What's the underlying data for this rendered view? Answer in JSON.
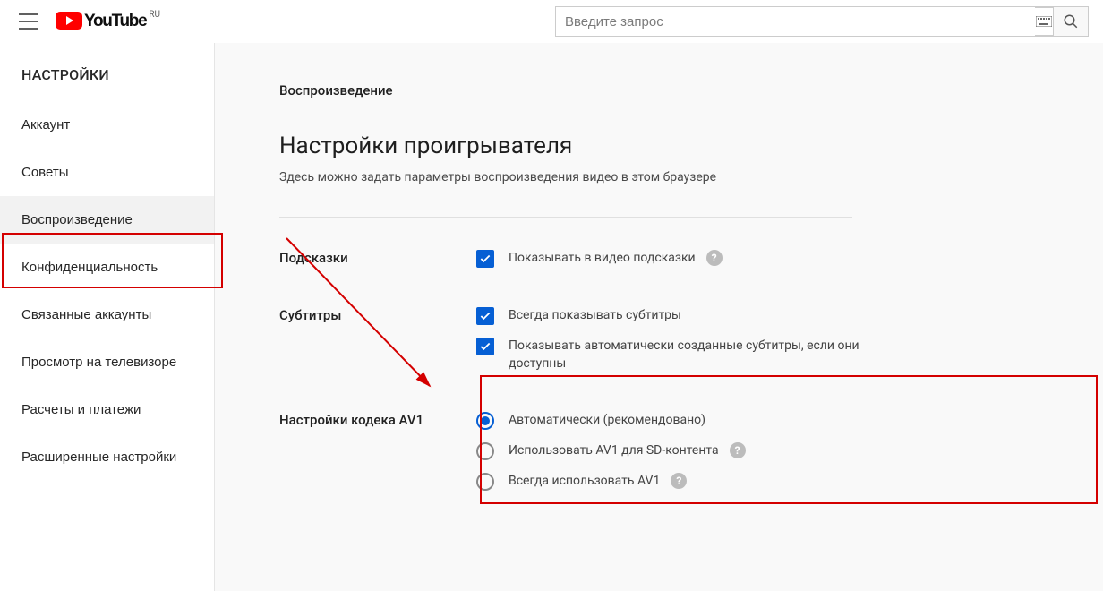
{
  "header": {
    "brand": "YouTube",
    "region": "RU",
    "search_placeholder": "Введите запрос"
  },
  "sidebar": {
    "title": "НАСТРОЙКИ",
    "items": [
      {
        "label": "Аккаунт"
      },
      {
        "label": "Советы"
      },
      {
        "label": "Воспроизведение",
        "active": true
      },
      {
        "label": "Конфиденциальность"
      },
      {
        "label": "Связанные аккаунты"
      },
      {
        "label": "Просмотр на телевизоре"
      },
      {
        "label": "Расчеты и платежи"
      },
      {
        "label": "Расширенные настройки"
      }
    ]
  },
  "page": {
    "breadcrumb": "Воспроизведение",
    "title": "Настройки проигрывателя",
    "subtitle": "Здесь можно задать параметры воспроизведения видео в этом браузере",
    "sections": {
      "hints": {
        "label": "Подсказки",
        "options": [
          {
            "text": "Показывать в видео подсказки",
            "checked": true,
            "help": true
          }
        ]
      },
      "subtitles": {
        "label": "Субтитры",
        "options": [
          {
            "text": "Всегда показывать субтитры",
            "checked": true
          },
          {
            "text": "Показывать автоматически созданные субтитры, если они доступны",
            "checked": true
          }
        ]
      },
      "av1": {
        "label": "Настройки кодека AV1",
        "options": [
          {
            "text": "Автоматически (рекомендовано)",
            "selected": true
          },
          {
            "text": "Использовать AV1 для SD-контента",
            "help": true
          },
          {
            "text": "Всегда использовать AV1",
            "help": true
          }
        ]
      }
    }
  }
}
